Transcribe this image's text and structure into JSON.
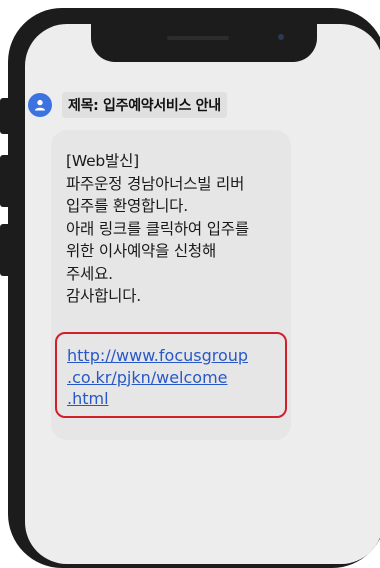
{
  "message": {
    "subject": "제목: 입주예약서비스 안내",
    "body_lines": [
      "[Web발신]",
      "파주운정 경남아너스빌 리버",
      "입주를 환영합니다.",
      "아래 링크를 클릭하여 입주를",
      "위한 이사예약을 신청해",
      "주세요.",
      "감사합니다."
    ],
    "link_lines": [
      "http://www.focusgroup",
      ".co.kr/pjkn/welcome",
      ".html"
    ]
  },
  "colors": {
    "avatar": "#3d73e0",
    "link": "#2858c8",
    "highlight_border": "#d0202a"
  },
  "icons": {
    "avatar": "person-icon"
  }
}
